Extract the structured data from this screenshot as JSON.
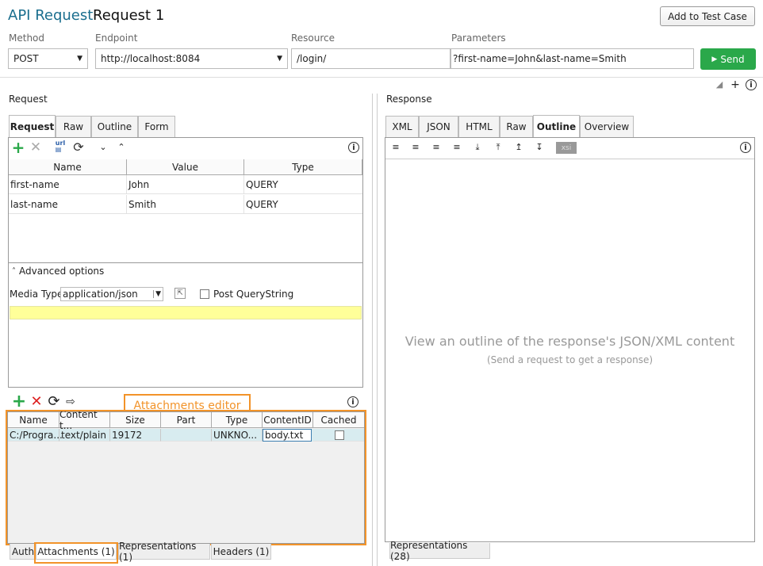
{
  "header": {
    "app_label": "API Request",
    "request_name": "Request 1",
    "add_button": "Add to Test Case"
  },
  "fields": {
    "method_label": "Method",
    "method_value": "POST",
    "endpoint_label": "Endpoint",
    "endpoint_value": "http://localhost:8084",
    "resource_label": "Resource",
    "resource_value": "/login/",
    "params_label": "Parameters",
    "params_value": "?first-name=John&last-name=Smith",
    "send_label": "Send"
  },
  "request": {
    "title": "Request",
    "tabs": [
      "Request",
      "Raw",
      "Outline",
      "Form"
    ],
    "columns": [
      "Name",
      "Value",
      "Type"
    ],
    "rows": [
      [
        "first-name",
        "John",
        "QUERY"
      ],
      [
        "last-name",
        "Smith",
        "QUERY"
      ]
    ],
    "advanced": "Advanced options",
    "media_label": "Media Type",
    "media_value": "application/json",
    "post_qs": "Post QueryString"
  },
  "attachments": {
    "callout": "Attachments editor",
    "columns": [
      "Name",
      "Content t...",
      "Size",
      "Part",
      "Type",
      "ContentID",
      "Cached"
    ],
    "rows": [
      [
        "C:/Progra...",
        "text/plain",
        "19172",
        "",
        "UNKNO...",
        "body.txt",
        ""
      ]
    ],
    "tabs": [
      "Auth",
      "Attachments (1)",
      "Representations (1)",
      "Headers (1)"
    ]
  },
  "response": {
    "title": "Response",
    "tabs": [
      "XML",
      "JSON",
      "HTML",
      "Raw",
      "Outline",
      "Overview"
    ],
    "empty_main": "View an outline of the response's JSON/XML content",
    "empty_sub": "(Send a request to get a response)",
    "bottom_tab": "Representations (28)",
    "xsi": "xsi"
  },
  "colors": {
    "accent": "#1a6e8e",
    "send": "#2aa84a",
    "highlight": "#f29329",
    "yellow": "#ffff99"
  }
}
